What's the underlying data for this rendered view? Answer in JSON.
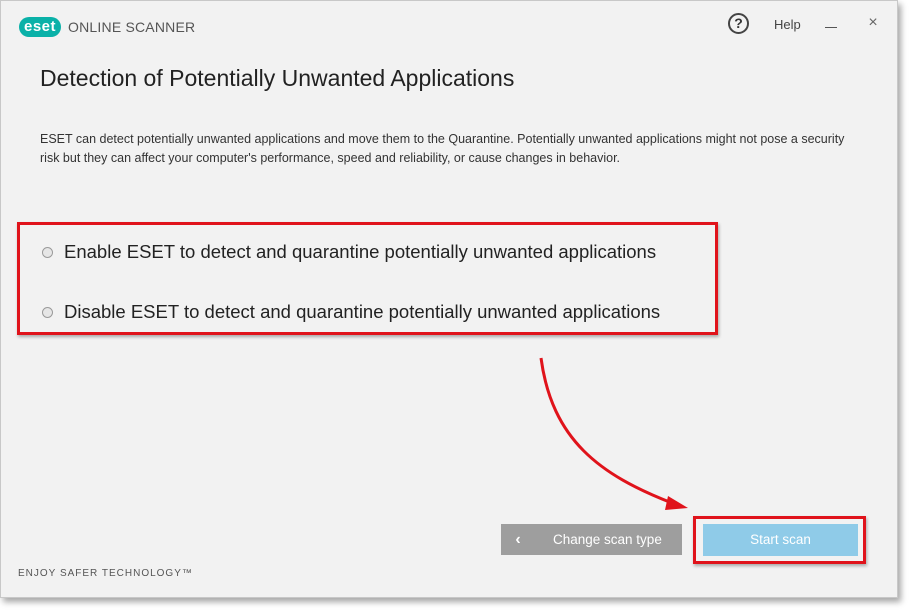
{
  "titlebar": {
    "logo_badge": "eset",
    "logo_text": "ONLINE SCANNER",
    "help_icon": "?",
    "help_label": "Help",
    "close_glyph": "×"
  },
  "main": {
    "title": "Detection of Potentially Unwanted Applications",
    "description": "ESET can detect potentially unwanted applications and move them to the Quarantine. Potentially unwanted applications might not pose a security risk but they can affect your computer's performance, speed and reliability, or cause changes in behavior.",
    "options": [
      {
        "label": "Enable ESET to detect and quarantine potentially unwanted applications",
        "selected": false
      },
      {
        "label": "Disable ESET to detect and quarantine potentially unwanted applications",
        "selected": false
      }
    ]
  },
  "footer": {
    "back_label": "Change scan type",
    "back_icon": "chevron-left-icon",
    "start_label": "Start scan",
    "tagline": "ENJOY SAFER TECHNOLOGY™"
  },
  "colors": {
    "brand": "#0ab1a8",
    "highlight": "#e0131b",
    "start_button": "#8fcbe8",
    "back_button": "#9e9e9e"
  }
}
